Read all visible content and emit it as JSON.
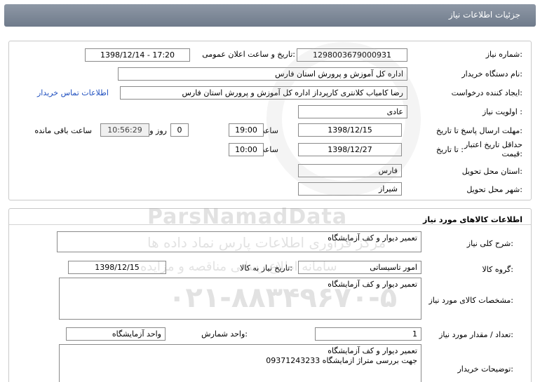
{
  "header": {
    "title": "جزئیات اطلاعات نیاز"
  },
  "need_info": {
    "need_number_label": "شماره نیاز:",
    "need_number": "1298003679000931",
    "announce_label": "تاریخ و ساعت اعلان عمومی:",
    "announce_value": "1398/12/14 - 17:20",
    "buyer_org_label": "نام دستگاه خریدار:",
    "buyer_org": "اداره کل آموزش و پرورش استان فارس",
    "requester_label": "ایجاد کننده درخواست:",
    "requester": "رضا کامیاب کلانتری کارپرداز اداره کل آموزش و پرورش استان فارس",
    "contact_link": "اطلاعات تماس خریدار",
    "priority_label": "اولویت نیاز :",
    "priority": "عادی",
    "reply_deadline_label": "مهلت ارسال پاسخ:",
    "until_date_label": "تا تاریخ :",
    "reply_date": "1398/12/15",
    "time_label": "ساعت",
    "reply_time": "19:00",
    "days_value": "0",
    "days_label": "روز و",
    "remaining_time": "10:56:29",
    "remaining_label": "ساعت باقی مانده",
    "validity_label_line1": "حداقل تاریخ اعتبار",
    "validity_label_line2": "قیمت:",
    "validity_until_label": "تا تاریخ :",
    "validity_date": "1398/12/27",
    "validity_time_label": "ساعت",
    "validity_time": "10:00",
    "province_label": "استان محل تحویل:",
    "province": "فارس",
    "city_label": "شهر محل تحویل:",
    "city": "شیراز"
  },
  "goods": {
    "section_title": "اطلاعات کالاهای مورد نیاز",
    "summary_label": "شرح کلی نیاز:",
    "summary": "تعمیر دیوار و کف آزمایشگاه",
    "group_label": "گروه کالا:",
    "group": "امور تاسیساتی",
    "need_date_label": "تاریخ نیاز به کالا:",
    "need_date": "1398/12/15",
    "specs_label": "مشخصات کالای مورد نیاز:",
    "specs": "تعمیر دیوار و کف آزمایشگاه",
    "qty_label": "تعداد / مقدار مورد نیاز:",
    "qty": "1",
    "unit_label": "واحد شمارش:",
    "unit": "واحد آزمایشگاه",
    "buyer_notes_label": "توضیحات خریدار:",
    "buyer_notes": "تعمیر دیوار و کف آزمایشگاه\nجهت بررسی متراژ ازمایشگاه 09371243233"
  },
  "watermark": {
    "brand": "ParsNamadData",
    "line_fa": "مرکز فراوری اطلاعات پارس نماد داده ها",
    "line_fa2": "سامانه اطلاع رسانی مناقصه و مزایده",
    "phone": "۰۲۱-۸۸۳۴۹۶۷۰-۵"
  },
  "colors": {
    "header_bg": "#7f8a99",
    "link": "#1f4fbf",
    "border": "#8a8a8a"
  }
}
